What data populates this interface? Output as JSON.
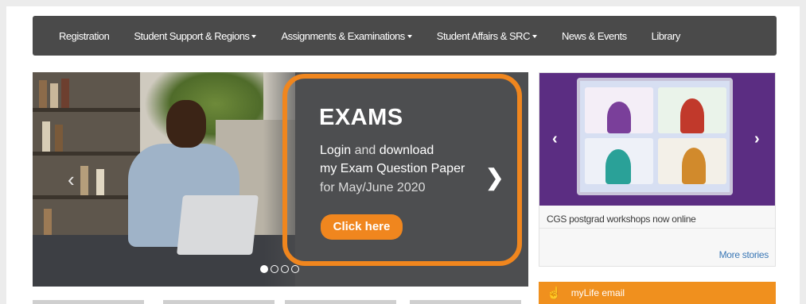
{
  "nav": {
    "items": [
      {
        "label": "Registration",
        "has_dropdown": false
      },
      {
        "label": "Student Support & Regions",
        "has_dropdown": true
      },
      {
        "label": "Assignments & Examinations",
        "has_dropdown": true
      },
      {
        "label": "Student Affairs & SRC",
        "has_dropdown": true
      },
      {
        "label": "News & Events",
        "has_dropdown": false
      },
      {
        "label": "Library",
        "has_dropdown": false
      }
    ]
  },
  "hero": {
    "title": "EXAMS",
    "line1_a": "Login",
    "line1_b": " and ",
    "line1_c": "download",
    "line2": "my Exam Question Paper",
    "line3": "for May/June 2020",
    "button": "Click here",
    "next_icon": "chevron-right-icon",
    "prev_icon": "chevron-left-icon",
    "highlight_color": "#f0861e",
    "slide_count": 4,
    "active_slide": 1
  },
  "news": {
    "caption": "CGS postgrad workshops now online",
    "more": "More stories",
    "prev_icon": "chevron-left-icon",
    "next_icon": "chevron-right-icon",
    "panel_color": "#5b2d82"
  },
  "mylife": {
    "label": "myLife email",
    "icon": "pointing-hand-icon",
    "color": "#f0901e"
  }
}
